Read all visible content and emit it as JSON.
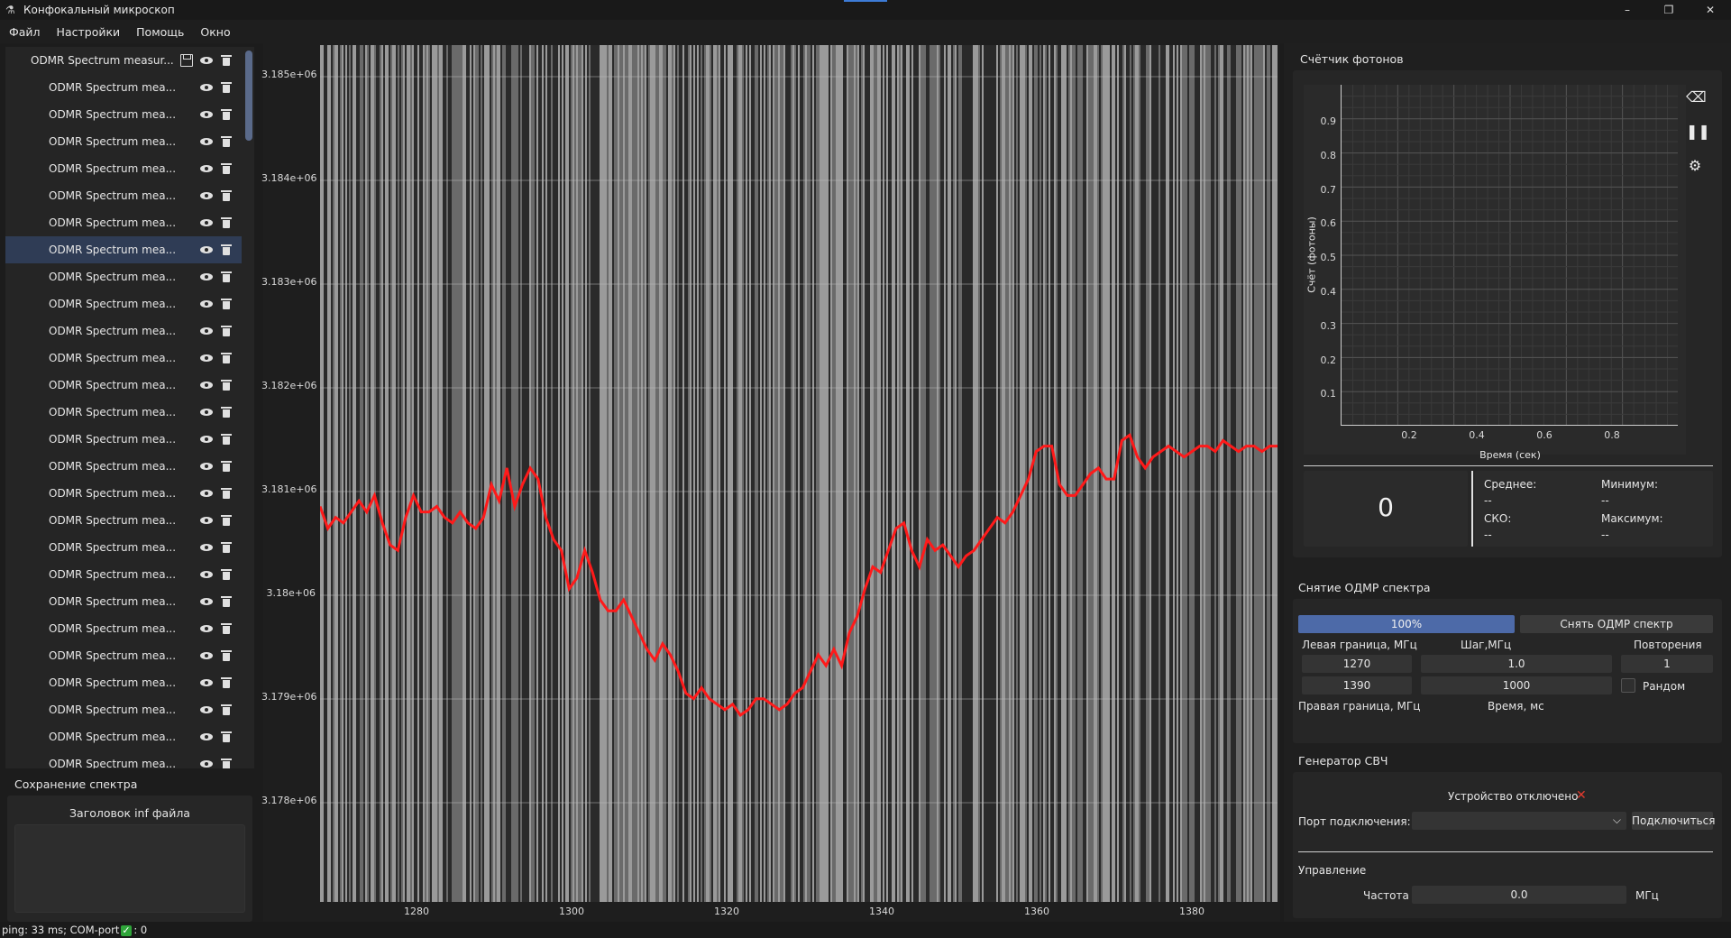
{
  "window": {
    "title": "Конфокальный микроскоп",
    "minimize": "–",
    "maximize": "❐",
    "close": "✕"
  },
  "menu": [
    "Файл",
    "Настройки",
    "Помощь",
    "Окно"
  ],
  "tree": {
    "root_label": "ODMR Spectrum measur...",
    "child_label": "ODMR Spectrum mea...",
    "child_count": 27,
    "selected_index": 7
  },
  "save_section": {
    "title": "Сохранение спектра",
    "header_label": "Заголовок inf файла",
    "header_value": ""
  },
  "spectrum_plot": {
    "y_ticks": [
      "3.185e+06",
      "3.184e+06",
      "3.183e+06",
      "3.182e+06",
      "3.181e+06",
      "3.18e+06",
      "3.179e+06",
      "3.178e+06"
    ],
    "x_ticks": [
      "1280",
      "1300",
      "1320",
      "1340",
      "1360",
      "1380"
    ],
    "line_color": "#ff1a1a"
  },
  "chart_data": {
    "type": "line",
    "title": "",
    "xlabel": "",
    "ylabel": "",
    "xlim": [
      1270,
      1393
    ],
    "ylim": [
      3177500,
      3185300
    ],
    "series": [
      {
        "color": "#ff1a1a",
        "x": [
          1270,
          1271,
          1272,
          1273,
          1274,
          1275,
          1276,
          1277,
          1278,
          1279,
          1280,
          1281,
          1282,
          1283,
          1284,
          1285,
          1286,
          1287,
          1288,
          1289,
          1290,
          1291,
          1292,
          1293,
          1294,
          1295,
          1296,
          1297,
          1298,
          1299,
          1300,
          1301,
          1302,
          1303,
          1304,
          1305,
          1306,
          1307,
          1308,
          1309,
          1310,
          1311,
          1312,
          1313,
          1314,
          1315,
          1316,
          1317,
          1318,
          1319,
          1320,
          1321,
          1322,
          1323,
          1324,
          1325,
          1326,
          1327,
          1328,
          1329,
          1330,
          1331,
          1332,
          1333,
          1334,
          1335,
          1336,
          1337,
          1338,
          1339,
          1340,
          1341,
          1342,
          1343,
          1344,
          1345,
          1346,
          1347,
          1348,
          1349,
          1350,
          1351,
          1352,
          1353,
          1354,
          1355,
          1356,
          1357,
          1358,
          1359,
          1360,
          1361,
          1362,
          1363,
          1364,
          1365,
          1366,
          1367,
          1368,
          1369,
          1370,
          1371,
          1372,
          1373,
          1374,
          1375,
          1376,
          1377,
          1378,
          1379,
          1380,
          1381,
          1382,
          1383,
          1384,
          1385,
          1386,
          1387,
          1388,
          1389,
          1390,
          1391,
          1392,
          1393
        ],
        "y": [
          3181100,
          3180900,
          3181000,
          3180950,
          3181050,
          3181150,
          3181050,
          3181200,
          3180950,
          3180750,
          3180700,
          3181000,
          3181200,
          3181050,
          3181050,
          3181100,
          3181000,
          3180950,
          3181050,
          3180950,
          3180900,
          3181000,
          3181300,
          3181150,
          3181450,
          3181100,
          3181300,
          3181450,
          3181350,
          3181000,
          3180800,
          3180700,
          3180350,
          3180450,
          3180700,
          3180500,
          3180250,
          3180150,
          3180150,
          3180250,
          3180100,
          3179950,
          3179800,
          3179700,
          3179850,
          3179750,
          3179600,
          3179400,
          3179350,
          3179450,
          3179350,
          3179300,
          3179250,
          3179300,
          3179200,
          3179250,
          3179350,
          3179350,
          3179300,
          3179250,
          3179300,
          3179400,
          3179450,
          3179600,
          3179750,
          3179650,
          3179800,
          3179650,
          3179950,
          3180100,
          3180350,
          3180550,
          3180500,
          3180700,
          3180900,
          3180950,
          3180700,
          3180550,
          3180800,
          3180700,
          3180750,
          3180650,
          3180550,
          3180650,
          3180700,
          3180800,
          3180900,
          3181000,
          3180950,
          3181050,
          3181200,
          3181350,
          3181600,
          3181650,
          3181650,
          3181300,
          3181200,
          3181200,
          3181300,
          3181400,
          3181450,
          3181350,
          3181350,
          3181700,
          3181750,
          3181550,
          3181450,
          3181550,
          3181600,
          3181650,
          3181600,
          3181550,
          3181600,
          3181650,
          3181650,
          3181600,
          3181700,
          3181650,
          3181600,
          3181650,
          3181650,
          3181600,
          3181650,
          3181650
        ]
      }
    ]
  },
  "photon_counter": {
    "title": "Счётчик фотонов",
    "y_label": "Счёт (фотоны)",
    "x_label": "Время (сек)",
    "y_ticks": [
      "0.9",
      "0.8",
      "0.7",
      "0.6",
      "0.5",
      "0.4",
      "0.3",
      "0.2",
      "0.1"
    ],
    "x_ticks": [
      "0.2",
      "0.4",
      "0.6",
      "0.8"
    ],
    "value": "0",
    "stats": {
      "mean_label": "Среднее:",
      "mean_value": "--",
      "std_label": "СКО:",
      "std_value": "--",
      "min_label": "Минимум:",
      "min_value": "--",
      "max_label": "Максимум:",
      "max_value": "--"
    }
  },
  "odmr": {
    "title": "Снятие ОДМР спектра",
    "progress": "100%",
    "run_button": "Снять ОДМР спектр",
    "left_bound_label": "Левая граница, МГц",
    "right_bound_label": "Правая граница, МГц",
    "step_label": "Шаг,МГц",
    "time_label": "Время, мс",
    "repeat_label": "Повторения",
    "random_label": "Рандом",
    "left_value": "1270",
    "right_value": "1390",
    "step_value": "1.0",
    "time_value": "1000",
    "repeat_value": "1"
  },
  "mw_generator": {
    "title": "Генератор СВЧ",
    "status": "Устройство отключено",
    "port_label": "Порт подключения:",
    "port_value": "",
    "connect_button": "Подключиться",
    "control_label": "Управление",
    "freq_label": "Частота",
    "freq_value": "0.0",
    "freq_unit": "МГц"
  },
  "status_bar": {
    "ping": "ping: 33 ms; COM-port",
    "count": ": 0"
  }
}
